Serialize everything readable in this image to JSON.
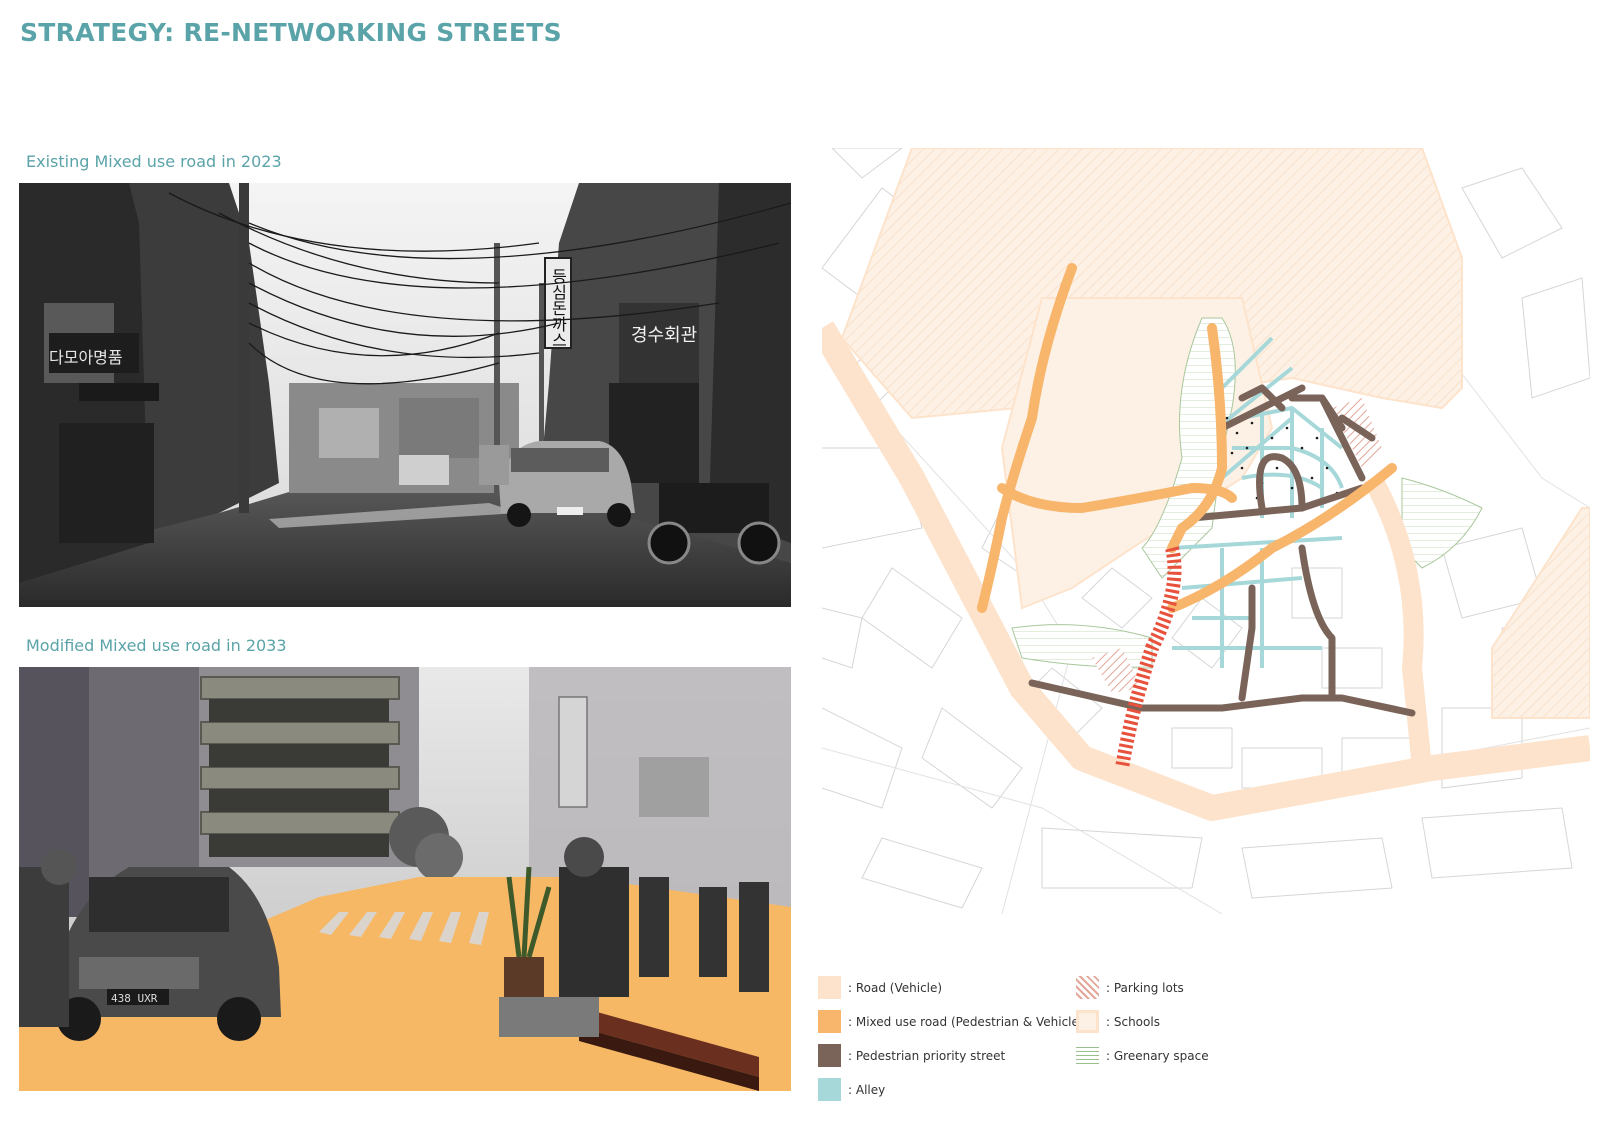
{
  "page": {
    "title": "STRATEGY: RE-NETWORKING STREETS"
  },
  "photos": [
    {
      "caption": "Existing Mixed use road in 2023",
      "icon": "street-photo-icon"
    },
    {
      "caption": "Modified Mixed use road in 2033",
      "icon": "street-collage-icon"
    }
  ],
  "photo_signs": {
    "sign_1": "등심돈까스",
    "sign_2": "경수회관",
    "sign_3": "다모아명품",
    "plate": "438 UXR"
  },
  "legend": {
    "items": [
      {
        "label": ": Road (Vehicle)",
        "color": "#fde3cb",
        "pattern": "solid"
      },
      {
        "label": ": Mixed use road (Pedestrian & Vehicle)",
        "color": "#f8b56c",
        "pattern": "solid"
      },
      {
        "label": ": Pedestrian priority street",
        "color": "#7a6459",
        "pattern": "solid"
      },
      {
        "label": ": Alley",
        "color": "#a7d8d9",
        "pattern": "solid"
      },
      {
        "label": ": Parking lots",
        "color": "#e3a79a",
        "pattern": "hatch-diagonal"
      },
      {
        "label": ": Schools",
        "color": "#fde3cb",
        "pattern": "outline"
      },
      {
        "label": ": Greenary space",
        "color": "#9bbf8c",
        "pattern": "hatch-horizontal"
      }
    ]
  },
  "colors": {
    "accent": "#5aa3a8",
    "road_vehicle": "#fde3cb",
    "mixed_use_road": "#f8b56c",
    "pedestrian_priority": "#7a6459",
    "alley": "#a7d8d9",
    "new_crossing": "#e8523d",
    "school_fill": "#fdf1e5",
    "green_hatch": "#b9d2ad"
  }
}
